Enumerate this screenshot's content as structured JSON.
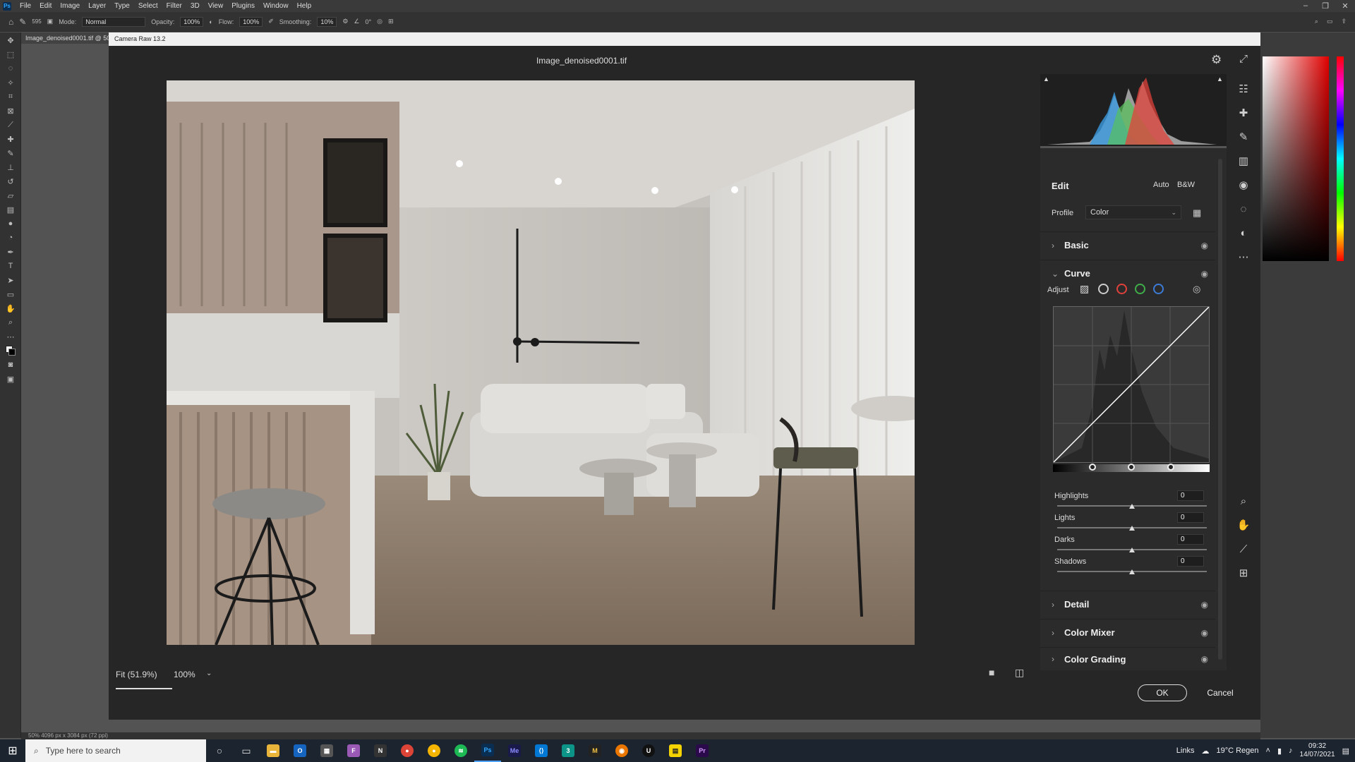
{
  "ps": {
    "logo": "Ps",
    "menu": [
      "File",
      "Edit",
      "Image",
      "Layer",
      "Type",
      "Select",
      "Filter",
      "3D",
      "View",
      "Plugins",
      "Window",
      "Help"
    ],
    "options": {
      "brush_size": "595",
      "mode_label": "Mode:",
      "mode_value": "Normal",
      "opacity_label": "Opacity:",
      "opacity_value": "100%",
      "flow_label": "Flow:",
      "flow_value": "100%",
      "smoothing_label": "Smoothing:",
      "smoothing_value": "10%",
      "angle_value": "0°"
    },
    "doc_tab": "Image_denoised0001.tif @ 50",
    "status": "50%      4096 px x 3084 px (72 ppi)"
  },
  "camera_raw": {
    "title_bar": "Camera Raw 13.2",
    "file_name": "Image_denoised0001.tif",
    "zoom_fit": "Fit (51.9%)",
    "zoom_100": "100%",
    "ok": "OK",
    "cancel": "Cancel",
    "edit": {
      "title": "Edit",
      "auto": "Auto",
      "bw": "B&W",
      "profile_label": "Profile",
      "profile_value": "Color"
    },
    "sections": {
      "basic": "Basic",
      "curve": "Curve",
      "detail": "Detail",
      "color_mixer": "Color Mixer",
      "color_grading": "Color Grading"
    },
    "curve": {
      "adjust_label": "Adjust",
      "sliders": [
        {
          "label": "Highlights",
          "value": "0"
        },
        {
          "label": "Lights",
          "value": "0"
        },
        {
          "label": "Darks",
          "value": "0"
        },
        {
          "label": "Shadows",
          "value": "0"
        }
      ],
      "split_points": [
        0.25,
        0.5,
        0.75
      ]
    }
  },
  "taskbar": {
    "search_placeholder": "Type here to search",
    "links": "Links",
    "weather": "19°C Regen",
    "time": "09:32",
    "date": "14/07/2021",
    "app_icons": [
      "file-explorer-icon",
      "outlook-icon",
      "calculator-icon",
      "windows-explorer-icon",
      "figma-icon",
      "nuke-icon",
      "blender-icon",
      "chrome-icon",
      "chrome-canary-icon",
      "app-red-icon",
      "spotify-icon",
      "photoshop-icon",
      "media-encoder-icon",
      "vscode-icon",
      "3dsmax-icon",
      "maya-icon",
      "blender2-icon",
      "blender3-icon",
      "unreal-icon",
      "substance-icon",
      "calculator2-icon",
      "sticky-notes-icon",
      "premiere-icon"
    ]
  },
  "colors": {
    "dialog_bg": "#262626",
    "panel_bg": "#2b2b2b",
    "accent_red": "#e0413a",
    "accent_green": "#3fae49",
    "accent_blue": "#3c7bd6"
  }
}
